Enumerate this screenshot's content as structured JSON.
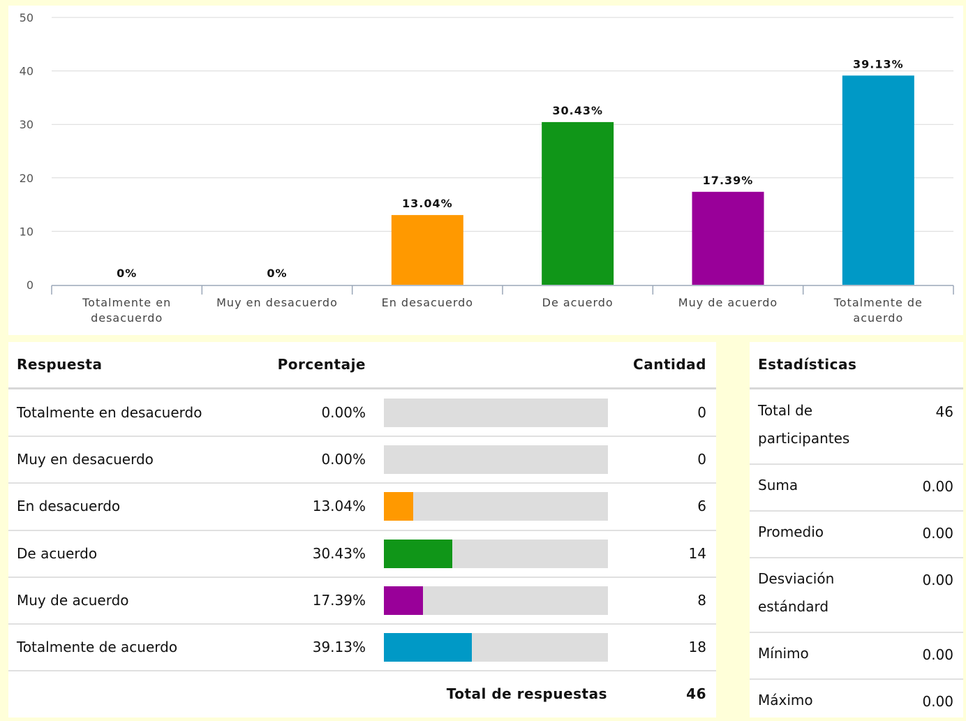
{
  "chart_data": {
    "type": "bar",
    "categories": [
      "Totalmente en desacuerdo",
      "Muy en desacuerdo",
      "En desacuerdo",
      "De acuerdo",
      "Muy de acuerdo",
      "Totalmente de acuerdo"
    ],
    "category_tick_labels": [
      [
        "Totalmente en",
        "desacuerdo"
      ],
      [
        "Muy en desacuerdo"
      ],
      [
        "En desacuerdo"
      ],
      [
        "De acuerdo"
      ],
      [
        "Muy de acuerdo"
      ],
      [
        "Totalmente de",
        "acuerdo"
      ]
    ],
    "values": [
      0,
      0,
      13.04,
      30.43,
      17.39,
      39.13
    ],
    "data_labels": [
      "0%",
      "0%",
      "13.04%",
      "30.43%",
      "17.39%",
      "39.13%"
    ],
    "colors": [
      "#cccccc",
      "#cccccc",
      "#ff9900",
      "#109618",
      "#990099",
      "#0099c6"
    ],
    "yticks": [
      0,
      10,
      20,
      30,
      40,
      50
    ],
    "ylim": [
      0,
      50
    ],
    "grid": true,
    "title": "",
    "xlabel": "",
    "ylabel": ""
  },
  "table": {
    "headers": {
      "respuesta": "Respuesta",
      "porcentaje": "Porcentaje",
      "cantidad": "Cantidad"
    },
    "rows": [
      {
        "label": "Totalmente en desacuerdo",
        "percent_text": "0.00%",
        "percent": 0.0,
        "count": "0",
        "color": "#ff9900"
      },
      {
        "label": "Muy en desacuerdo",
        "percent_text": "0.00%",
        "percent": 0.0,
        "count": "0",
        "color": "#ff9900"
      },
      {
        "label": "En desacuerdo",
        "percent_text": "13.04%",
        "percent": 13.04,
        "count": "6",
        "color": "#ff9900"
      },
      {
        "label": "De acuerdo",
        "percent_text": "30.43%",
        "percent": 30.43,
        "count": "14",
        "color": "#109618"
      },
      {
        "label": "Muy de acuerdo",
        "percent_text": "17.39%",
        "percent": 17.39,
        "count": "8",
        "color": "#990099"
      },
      {
        "label": "Totalmente de acuerdo",
        "percent_text": "39.13%",
        "percent": 39.13,
        "count": "18",
        "color": "#0099c6"
      }
    ],
    "total_label": "Total de respuestas",
    "total_value": "46"
  },
  "stats": {
    "header": "Estadísticas",
    "rows": [
      {
        "label": "Total de participantes",
        "value": "46"
      },
      {
        "label": "Suma",
        "value": "0.00"
      },
      {
        "label": "Promedio",
        "value": "0.00"
      },
      {
        "label": "Desviación estándard",
        "value": "0.00"
      },
      {
        "label": "Mínimo",
        "value": "0.00"
      },
      {
        "label": "Máximo",
        "value": "0.00"
      }
    ]
  }
}
